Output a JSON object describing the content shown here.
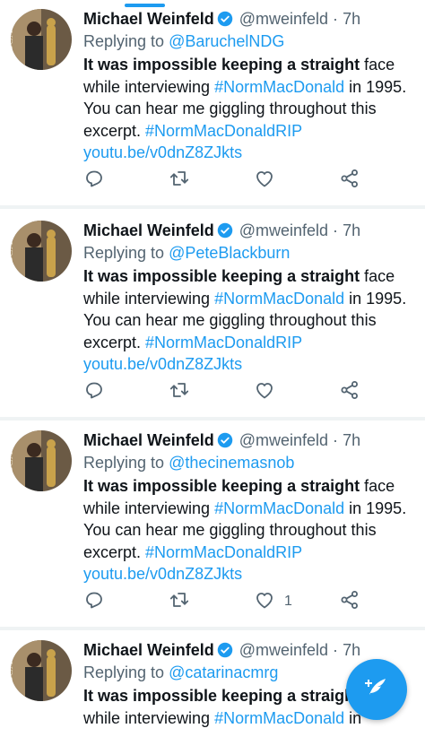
{
  "tweets": [
    {
      "name": "Michael Weinfeld",
      "handle": "@mweinfeld",
      "dot": "·",
      "time": "7h",
      "reply_prefix": "Replying to ",
      "reply_to": "@BaruchelNDG",
      "text_bold": "It was impossible keeping a straight",
      "text_1": " face while interviewing ",
      "hashtag_1": "#NormMacDonald",
      "text_2": " in 1995. You can hear me giggling throughout this excerpt. ",
      "hashtag_2": "#NormMacDonaldRIP",
      "url": "youtu.be/v0dnZ8ZJkts",
      "like_count": ""
    },
    {
      "name": "Michael Weinfeld",
      "handle": "@mweinfeld",
      "dot": "·",
      "time": "7h",
      "reply_prefix": "Replying to ",
      "reply_to": "@PeteBlackburn",
      "text_bold": "It was impossible keeping a straight",
      "text_1": " face while interviewing ",
      "hashtag_1": "#NormMacDonald",
      "text_2": " in 1995. You can hear me giggling throughout this excerpt. ",
      "hashtag_2": "#NormMacDonaldRIP",
      "url": "youtu.be/v0dnZ8ZJkts",
      "like_count": ""
    },
    {
      "name": "Michael Weinfeld",
      "handle": "@mweinfeld",
      "dot": "·",
      "time": "7h",
      "reply_prefix": "Replying to ",
      "reply_to": "@thecinemasnob",
      "text_bold": "It was impossible keeping a straight",
      "text_1": " face while interviewing ",
      "hashtag_1": "#NormMacDonald",
      "text_2": " in 1995. You can hear me giggling throughout this excerpt. ",
      "hashtag_2": "#NormMacDonaldRIP",
      "url": "youtu.be/v0dnZ8ZJkts",
      "like_count": "1"
    },
    {
      "name": "Michael Weinfeld",
      "handle": "@mweinfeld",
      "dot": "·",
      "time": "7h",
      "reply_prefix": "Replying to ",
      "reply_to": "@catarinacmrg",
      "text_bold": "It was impossible keeping a straight",
      "text_1": " face while interviewing ",
      "hashtag_1": "#NormMacDonald",
      "text_2": " in",
      "hashtag_2": "",
      "url": "",
      "like_count": ""
    }
  ],
  "icons": {
    "avatar": "avatar-oscars-photo",
    "verified": "verified-badge-icon",
    "reply": "reply-icon",
    "retweet": "retweet-icon",
    "like": "heart-icon",
    "share": "share-icon",
    "compose": "compose-tweet-icon"
  },
  "colors": {
    "accent": "#1d9bf0",
    "text": "#0f1419",
    "secondary": "#536471",
    "divider": "#eff3f4"
  }
}
